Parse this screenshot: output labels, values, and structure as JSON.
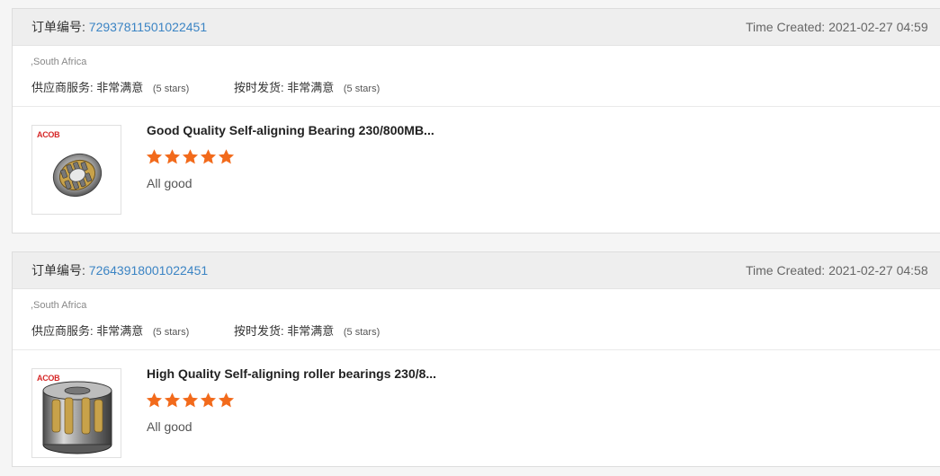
{
  "colors": {
    "accent_link": "#3b84c4",
    "star": "#f26a1b",
    "brand_logo": "#d62828",
    "header_bg": "#eeeeee"
  },
  "labels": {
    "order_number_label": "订单编号:",
    "time_created_label": "Time Created:",
    "supplier_service_label": "供应商服务:",
    "on_time_delivery_label": "按时发货:"
  },
  "orders": [
    {
      "order_number": "72937811501022451",
      "time_created": "2021-02-27 04:59",
      "country": ",South Africa",
      "supplier_service": {
        "value": "非常满意",
        "stars_note": "(5 stars)"
      },
      "on_time_delivery": {
        "value": "非常满意",
        "stars_note": "(5 stars)"
      },
      "product": {
        "brand": "ACOB",
        "title": "Good Quality Self-aligning Bearing 230/800MB...",
        "rating": 5,
        "rating_max": 5,
        "review": "All good",
        "image_icon": "bearing-icon"
      }
    },
    {
      "order_number": "72643918001022451",
      "time_created": "2021-02-27 04:58",
      "country": ",South Africa",
      "supplier_service": {
        "value": "非常满意",
        "stars_note": "(5 stars)"
      },
      "on_time_delivery": {
        "value": "非常满意",
        "stars_note": "(5 stars)"
      },
      "product": {
        "brand": "ACOB",
        "title": "High Quality Self-aligning roller bearings 230/8...",
        "rating": 5,
        "rating_max": 5,
        "review": "All good",
        "image_icon": "roller-bearing-icon"
      }
    }
  ]
}
